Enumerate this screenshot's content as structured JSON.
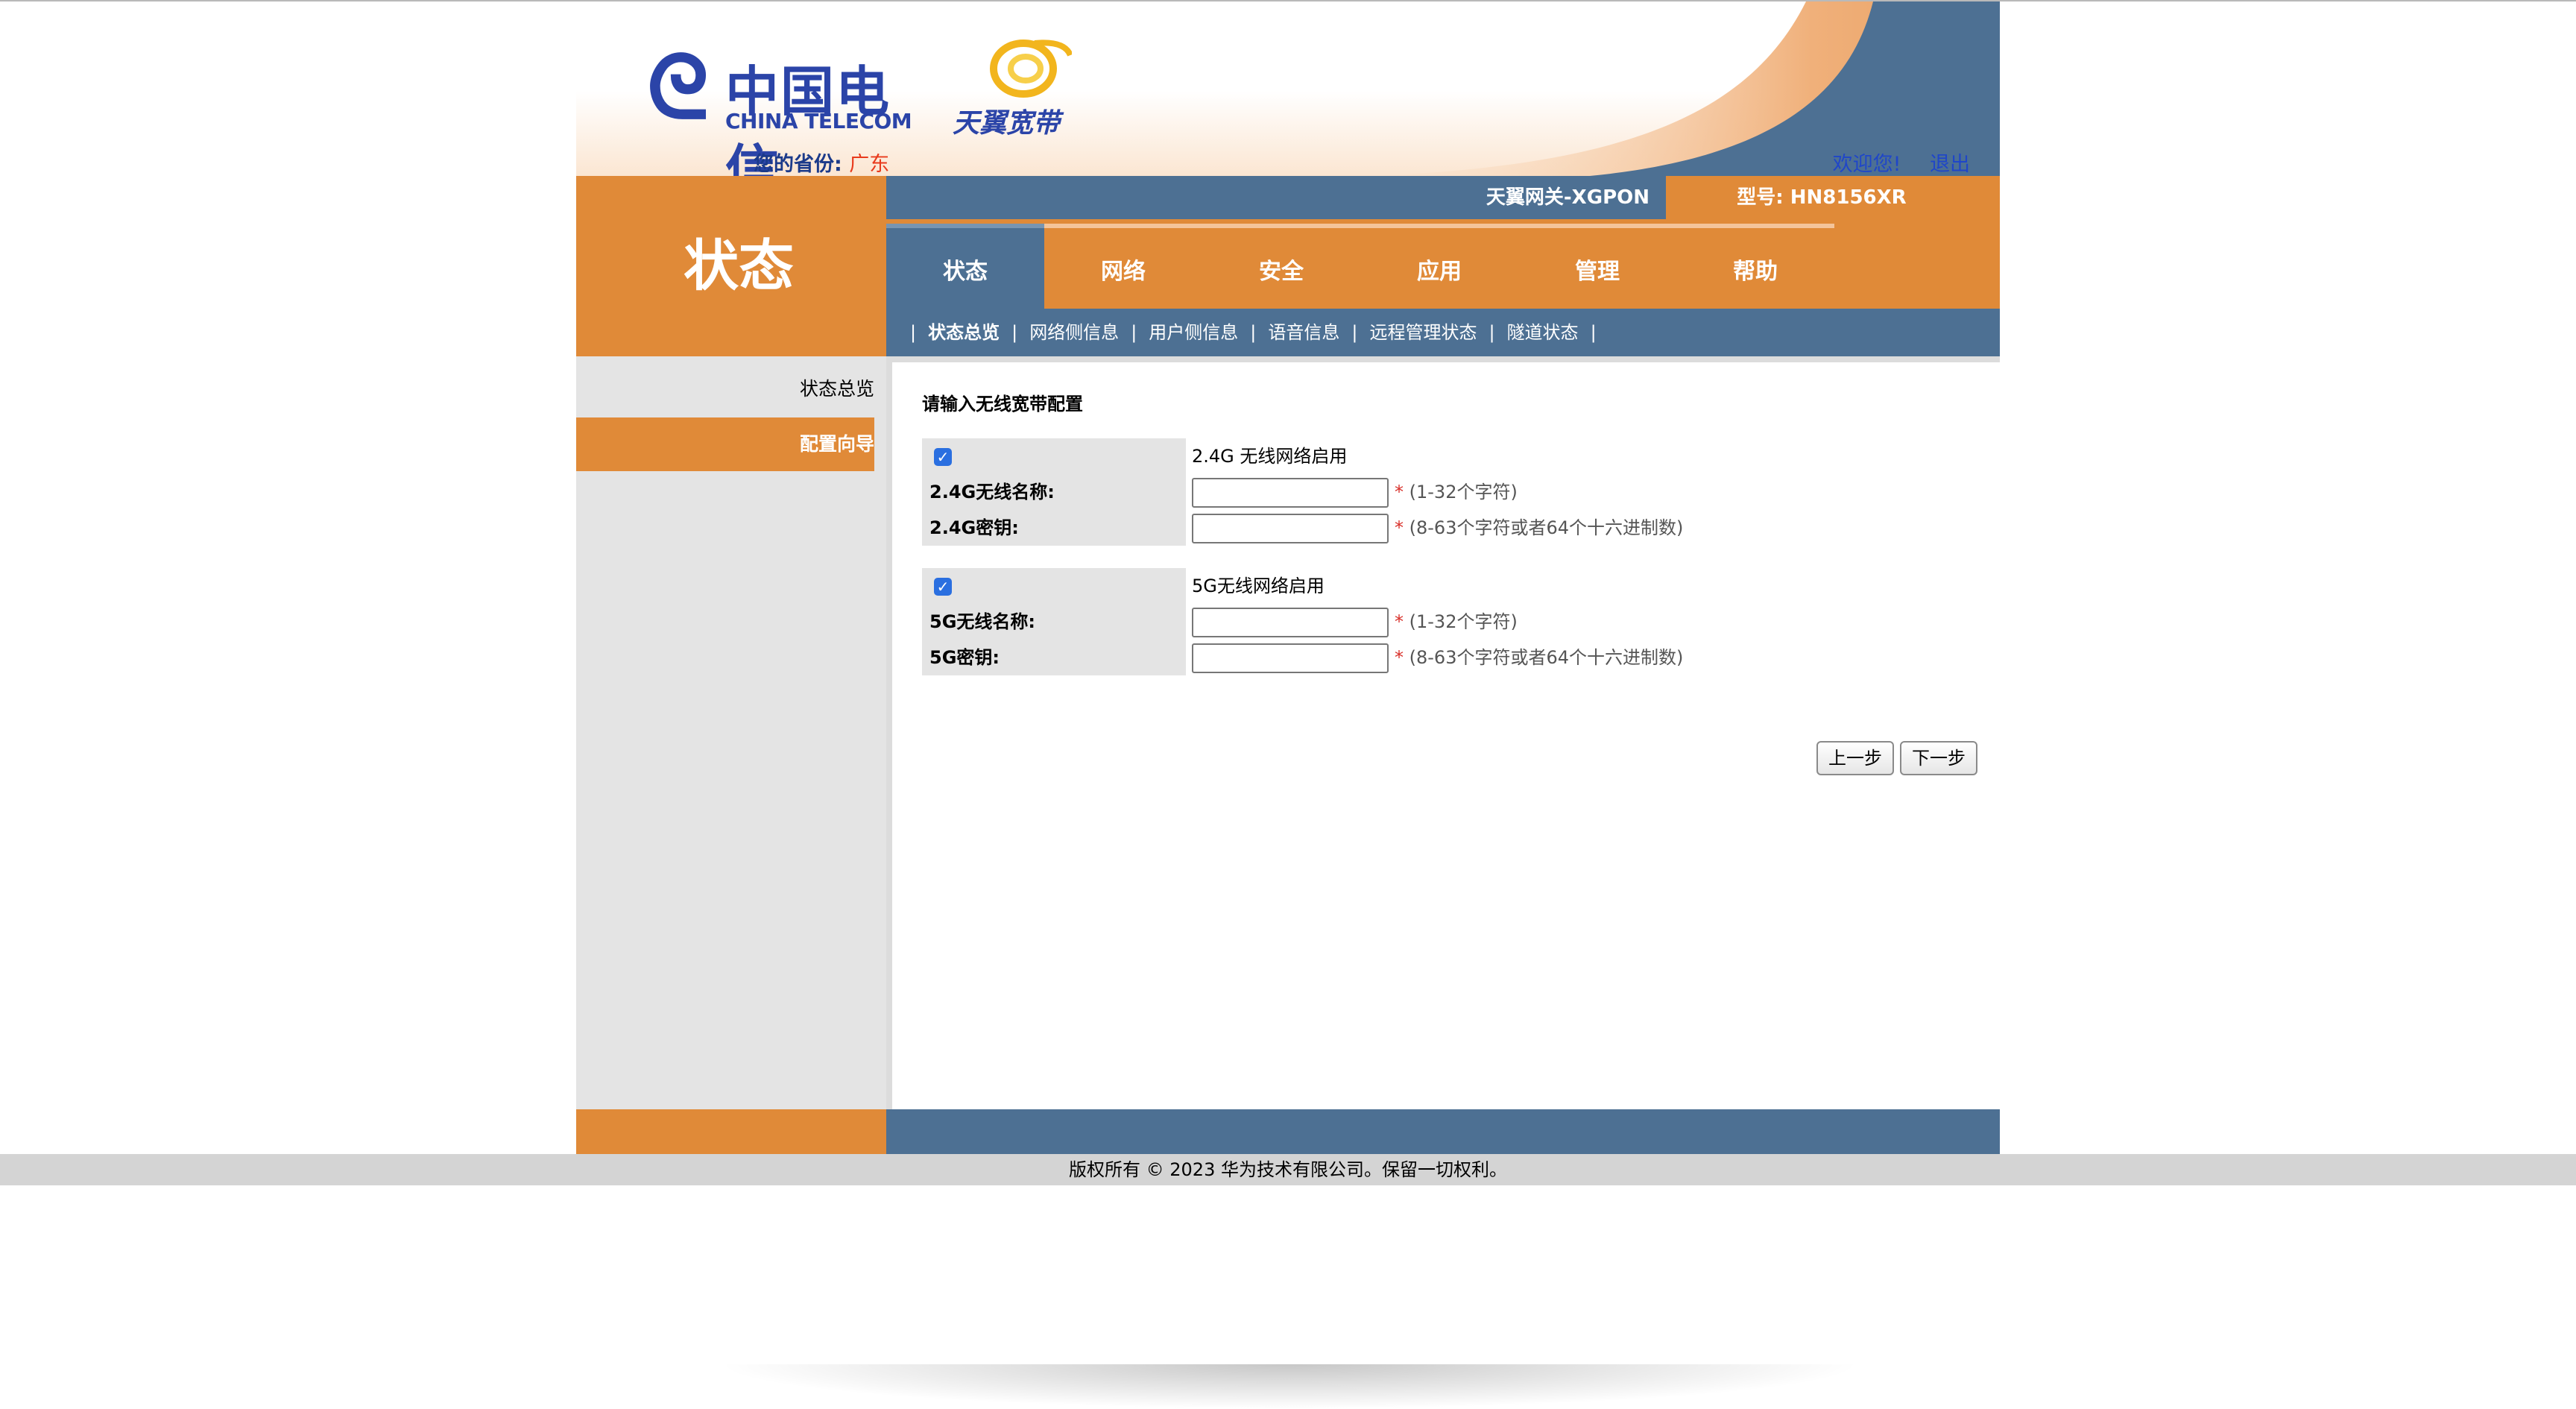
{
  "brand": {
    "logo_cn": "中国电信",
    "logo_en": "CHINA TELECOM",
    "sub_brand": "天翼宽带"
  },
  "header": {
    "province_label": "您的省份:",
    "province_value": "广东",
    "welcome": "欢迎您!",
    "logout": "退出"
  },
  "info": {
    "gateway_name": "天翼网关-XGPON",
    "model": "型号: HN8156XR"
  },
  "section_title": "状态",
  "tabs": [
    {
      "label": "状态",
      "active": true
    },
    {
      "label": "网络"
    },
    {
      "label": "安全"
    },
    {
      "label": "应用"
    },
    {
      "label": "管理"
    },
    {
      "label": "帮助"
    }
  ],
  "subnav": [
    "状态总览",
    "网络侧信息",
    "用户侧信息",
    "语音信息",
    "远程管理状态",
    "隧道状态"
  ],
  "sidebar": [
    "状态总览",
    "配置向导"
  ],
  "form": {
    "heading": "请输入无线宽带配置",
    "g24": {
      "enable_label": "2.4G 无线网络启用",
      "name_label": "2.4G无线名称:",
      "name_hint": "(1-32个字符)",
      "key_label": "2.4G密钥:",
      "key_hint": "(8-63个字符或者64个十六进制数)"
    },
    "g5": {
      "enable_label": "5G无线网络启用",
      "name_label": "5G无线名称:",
      "name_hint": "(1-32个字符)",
      "key_label": "5G密钥:",
      "key_hint": "(8-63个字符或者64个十六进制数)"
    },
    "required_mark": "*",
    "prev_button": "上一步",
    "next_button": "下一步"
  },
  "footer": {
    "copyright": "版权所有 © 2023 华为技术有限公司。保留一切权利。"
  },
  "colors": {
    "orange": "#e08a38",
    "blue": "#4d7093",
    "brand_blue": "#2b44a8"
  }
}
